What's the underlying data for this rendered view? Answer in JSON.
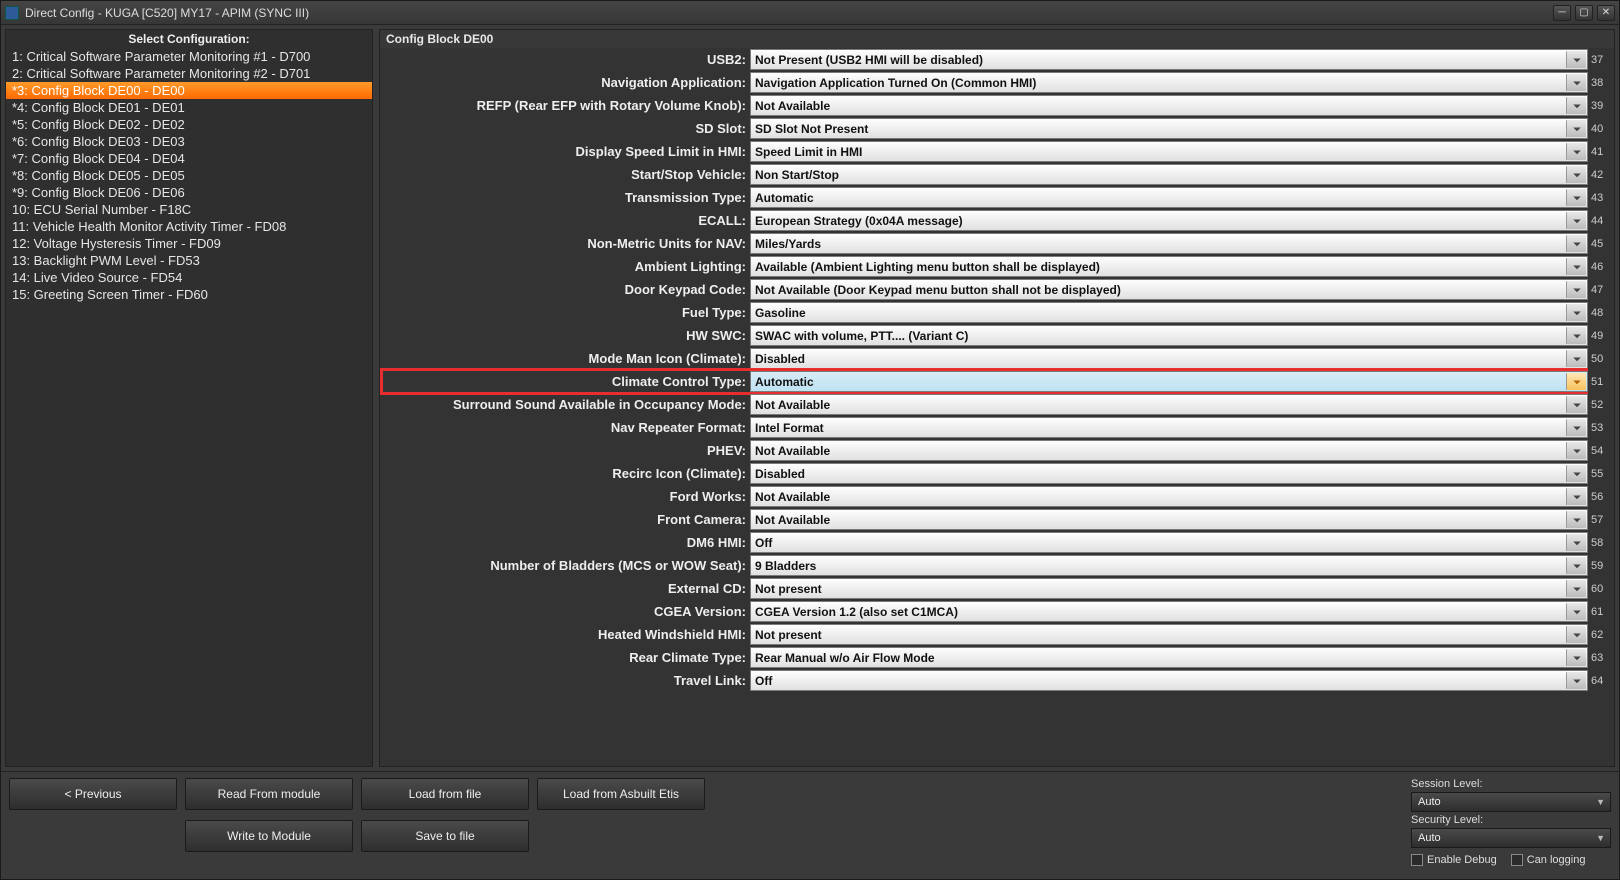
{
  "title": "Direct Config - KUGA [C520] MY17 - APIM (SYNC III)",
  "sidebar": {
    "header": "Select Configuration:",
    "items": [
      "1: Critical Software Parameter Monitoring #1 - D700",
      "2: Critical Software Parameter Monitoring #2 - D701",
      "*3: Config Block DE00 - DE00",
      "*4: Config Block DE01 - DE01",
      "*5: Config Block DE02 - DE02",
      "*6: Config Block DE03 - DE03",
      "*7: Config Block DE04 - DE04",
      "*8: Config Block DE05 - DE05",
      "*9: Config Block DE06 - DE06",
      "10: ECU Serial Number - F18C",
      "11: Vehicle Health Monitor Activity Timer - FD08",
      "12: Voltage Hysteresis Timer - FD09",
      "13: Backlight PWM Level - FD53",
      "14: Live Video Source - FD54",
      "15: Greeting Screen Timer - FD60"
    ],
    "selectedIndex": 2
  },
  "main": {
    "header": "Config Block DE00",
    "rows": [
      {
        "label": "USB2:",
        "value": "Not Present (USB2 HMI will be disabled)",
        "idx": "37"
      },
      {
        "label": "Navigation Application:",
        "value": "Navigation Application Turned On (Common HMI)",
        "idx": "38"
      },
      {
        "label": "REFP (Rear EFP with Rotary Volume Knob):",
        "value": "Not Available",
        "idx": "39"
      },
      {
        "label": "SD Slot:",
        "value": "SD Slot Not Present",
        "idx": "40"
      },
      {
        "label": "Display Speed Limit in HMI:",
        "value": "Speed Limit in HMI",
        "idx": "41"
      },
      {
        "label": "Start/Stop Vehicle:",
        "value": "Non Start/Stop",
        "idx": "42"
      },
      {
        "label": "Transmission Type:",
        "value": "Automatic",
        "idx": "43"
      },
      {
        "label": "ECALL:",
        "value": "European Strategy (0x04A message)",
        "idx": "44"
      },
      {
        "label": "Non-Metric Units for NAV:",
        "value": "Miles/Yards",
        "idx": "45"
      },
      {
        "label": "Ambient Lighting:",
        "value": "Available (Ambient Lighting menu button shall be displayed)",
        "idx": "46"
      },
      {
        "label": "Door Keypad Code:",
        "value": "Not Available (Door Keypad menu button shall not be displayed)",
        "idx": "47"
      },
      {
        "label": "Fuel Type:",
        "value": "Gasoline",
        "idx": "48"
      },
      {
        "label": "HW SWC:",
        "value": "SWAC with volume, PTT.... (Variant C)",
        "idx": "49"
      },
      {
        "label": "Mode Man Icon (Climate):",
        "value": "Disabled",
        "idx": "50"
      },
      {
        "label": "Climate Control Type:",
        "value": "Automatic",
        "idx": "51",
        "highlight": true
      },
      {
        "label": "Surround Sound Available in Occupancy Mode:",
        "value": "Not Available",
        "idx": "52"
      },
      {
        "label": "Nav Repeater Format:",
        "value": "Intel Format",
        "idx": "53"
      },
      {
        "label": "PHEV:",
        "value": "Not Available",
        "idx": "54"
      },
      {
        "label": "Recirc Icon (Climate):",
        "value": "Disabled",
        "idx": "55"
      },
      {
        "label": "Ford Works:",
        "value": "Not Available",
        "idx": "56"
      },
      {
        "label": "Front Camera:",
        "value": "Not Available",
        "idx": "57"
      },
      {
        "label": "DM6 HMI:",
        "value": "Off",
        "idx": "58"
      },
      {
        "label": "Number of Bladders (MCS or WOW Seat):",
        "value": "9 Bladders",
        "idx": "59"
      },
      {
        "label": "External CD:",
        "value": "Not present",
        "idx": "60"
      },
      {
        "label": "CGEA Version:",
        "value": "CGEA Version 1.2 (also set C1MCA)",
        "idx": "61"
      },
      {
        "label": "Heated Windshield HMI:",
        "value": "Not present",
        "idx": "62"
      },
      {
        "label": "Rear Climate Type:",
        "value": "Rear Manual w/o Air Flow Mode",
        "idx": "63"
      },
      {
        "label": "Travel Link:",
        "value": "Off",
        "idx": "64"
      }
    ]
  },
  "footer": {
    "buttons": {
      "previous": "< Previous",
      "read": "Read From module",
      "loadFile": "Load from file",
      "loadEtis": "Load from Asbuilt Etis",
      "write": "Write to Module",
      "saveFile": "Save to file"
    },
    "session": {
      "label": "Session Level:",
      "value": "Auto"
    },
    "security": {
      "label": "Security Level:",
      "value": "Auto"
    },
    "enableDebug": "Enable Debug",
    "canLogging": "Can logging"
  }
}
